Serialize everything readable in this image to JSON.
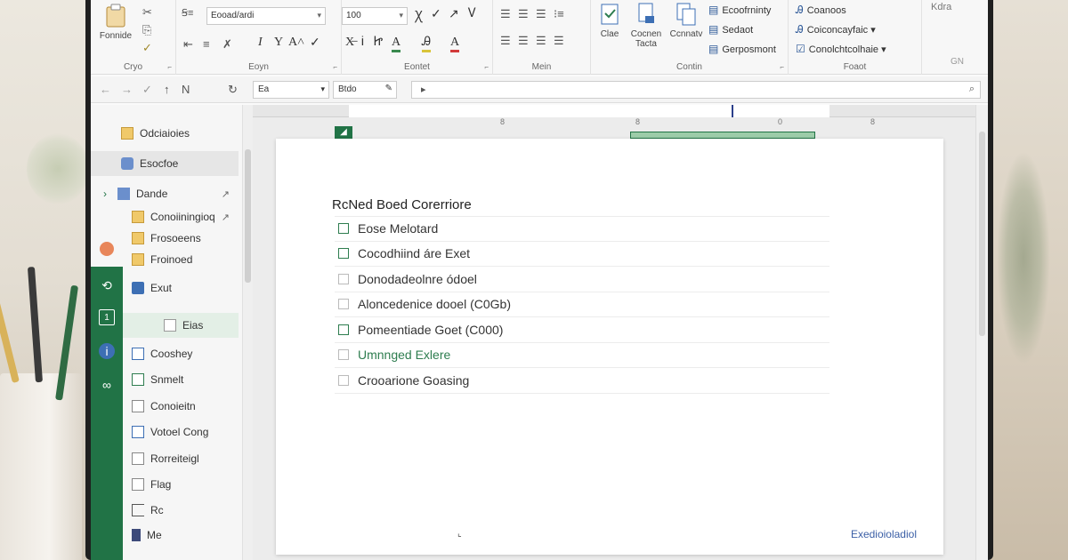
{
  "ribbon": {
    "clipboard": {
      "label": "Cryo",
      "paste_label": "Fonnide"
    },
    "font": {
      "label": "Eoyn",
      "font_name": "Eooad/ardi",
      "font_size": "100"
    },
    "paragraph": {
      "label": "Eontet"
    },
    "styles_group": {
      "label": "Mein"
    },
    "editing": {
      "label": "Contin",
      "btn1": "Clae",
      "btn2": "Cocnen Tacta",
      "btn3": "Ccnnatv"
    },
    "list_styles": [
      "Ecoofrninty",
      "Sedaot",
      "Gerposmont"
    ],
    "launch": {
      "label": "Foaot",
      "items": [
        "Coanoos",
        "Coiconcayfaic",
        "Conolchtcolhaie"
      ]
    },
    "corner": "Kdra",
    "corner_label": "GN"
  },
  "navbar": {
    "box1": "Ea",
    "box2": "Btdo"
  },
  "sidebar": {
    "items": [
      {
        "label": "Odciaioies"
      },
      {
        "label": "Esocfoe"
      },
      {
        "label": "Dande"
      },
      {
        "label": "Conoiiningioq"
      },
      {
        "label": "Frosoeens"
      },
      {
        "label": "Froinoed"
      },
      {
        "label": "Exut"
      },
      {
        "label": "Eias"
      },
      {
        "label": "Cooshey"
      },
      {
        "label": "Snmelt"
      },
      {
        "label": "Conoieitn"
      },
      {
        "label": "Votoel Cong"
      },
      {
        "label": "Rorreiteigl"
      },
      {
        "label": "Flag"
      },
      {
        "label": "Rc"
      },
      {
        "label": "Me"
      }
    ]
  },
  "ruler": {
    "marks": [
      "8",
      "8",
      "0",
      "8"
    ]
  },
  "document": {
    "title": "RcNed Boed Corerriore",
    "items": [
      {
        "text": "Eose Melotard",
        "checked": true,
        "green": false
      },
      {
        "text": "Cocodhiind áre Exet",
        "checked": true,
        "green": false
      },
      {
        "text": "Donodadeolnre ódoel",
        "checked": false,
        "green": false
      },
      {
        "text": "Aloncedenice dooel (C0Gb)",
        "checked": false,
        "green": false
      },
      {
        "text": "Pomeentiade Goet (C000)",
        "checked": true,
        "green": false
      },
      {
        "text": "Umnnged Exlere",
        "checked": false,
        "green": true
      },
      {
        "text": "Crooarione Goasing",
        "checked": false,
        "green": false
      }
    ],
    "footer": "Exedioioladiol"
  },
  "colors": {
    "accent": "#217346",
    "link": "#3b5fa6"
  }
}
